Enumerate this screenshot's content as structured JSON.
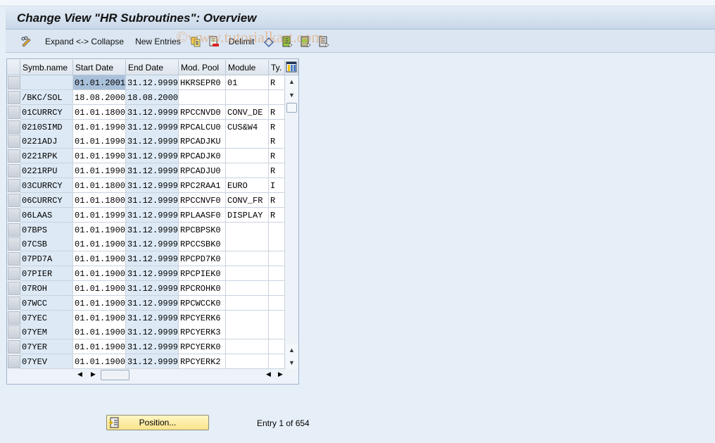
{
  "title": "Change View \"HR Subroutines\": Overview",
  "toolbar": {
    "expand_collapse": "Expand <-> Collapse",
    "new_entries": "New Entries",
    "delimit": "Delimit"
  },
  "watermark": "©www.tutorialkart.com",
  "table": {
    "columns": [
      "Symb.name",
      "Start Date",
      "End Date",
      "Mod. Pool",
      "Module",
      "Ty."
    ],
    "rows": [
      [
        "",
        "01.01.2001",
        "31.12.9999",
        "HKRSEPR0",
        "01",
        "R"
      ],
      [
        "/BKC/SOL",
        "18.08.2000",
        "18.08.2000",
        "",
        "",
        ""
      ],
      [
        "01CURRCY",
        "01.01.1800",
        "31.12.9999",
        "RPCCNVD0",
        "CONV_DE",
        "R"
      ],
      [
        "0210SIMD",
        "01.01.1990",
        "31.12.9999",
        "RPCALCU0",
        "CUS&W4",
        "R"
      ],
      [
        "0221ADJ",
        "01.01.1990",
        "31.12.9999",
        "RPCADJKU",
        "",
        "R"
      ],
      [
        "0221RPK",
        "01.01.1990",
        "31.12.9999",
        "RPCADJK0",
        "",
        "R"
      ],
      [
        "0221RPU",
        "01.01.1990",
        "31.12.9999",
        "RPCADJU0",
        "",
        "R"
      ],
      [
        "03CURRCY",
        "01.01.1800",
        "31.12.9999",
        "RPC2RAA1",
        "EURO",
        "I"
      ],
      [
        "06CURRCY",
        "01.01.1800",
        "31.12.9999",
        "RPCCNVF0",
        "CONV_FR",
        "R"
      ],
      [
        "06LAAS",
        "01.01.1999",
        "31.12.9999",
        "RPLAASF0",
        "DISPLAY",
        "R"
      ],
      [
        "07BPS",
        "01.01.1900",
        "31.12.9999",
        "RPCBPSK0",
        "",
        ""
      ],
      [
        "07CSB",
        "01.01.1900",
        "31.12.9999",
        "RPCCSBK0",
        "",
        ""
      ],
      [
        "07PD7A",
        "01.01.1900",
        "31.12.9999",
        "RPCPD7K0",
        "",
        ""
      ],
      [
        "07PIER",
        "01.01.1900",
        "31.12.9999",
        "RPCPIEK0",
        "",
        ""
      ],
      [
        "07ROH",
        "01.01.1900",
        "31.12.9999",
        "RPCROHK0",
        "",
        ""
      ],
      [
        "07WCC",
        "01.01.1900",
        "31.12.9999",
        "RPCWCCK0",
        "",
        ""
      ],
      [
        "07YEC",
        "01.01.1900",
        "31.12.9999",
        "RPCYERK6",
        "",
        ""
      ],
      [
        "07YEM",
        "01.01.1900",
        "31.12.9999",
        "RPCYERK3",
        "",
        ""
      ],
      [
        "07YER",
        "01.01.1900",
        "31.12.9999",
        "RPCYERK0",
        "",
        ""
      ],
      [
        "07YEV",
        "01.01.1900",
        "31.12.9999",
        "RPCYERK2",
        "",
        ""
      ]
    ]
  },
  "footer": {
    "position_button": "Position...",
    "entry_info": "Entry 1 of 654"
  },
  "colors": {
    "selected_cell": "#a9c0da",
    "key_column": "#dde9f5",
    "button": "#f9e38a"
  }
}
